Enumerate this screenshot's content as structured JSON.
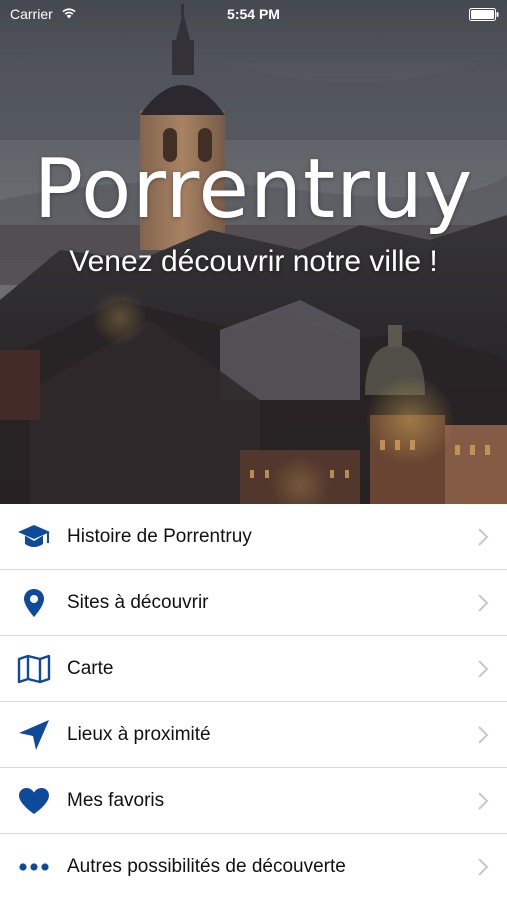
{
  "status_bar": {
    "carrier": "Carrier",
    "time": "5:54 PM"
  },
  "hero": {
    "title": "Porrentruy",
    "subtitle": "Venez découvrir notre ville !"
  },
  "colors": {
    "accent": "#0d4a9c",
    "separator": "#d9d9dc",
    "chevron": "#c7c7cc"
  },
  "menu": {
    "items": [
      {
        "label": "Histoire de Porrentruy",
        "icon": "graduation-cap-icon"
      },
      {
        "label": "Sites à découvrir",
        "icon": "map-pin-icon"
      },
      {
        "label": "Carte",
        "icon": "folded-map-icon"
      },
      {
        "label": "Lieux à proximité",
        "icon": "location-arrow-icon"
      },
      {
        "label": "Mes favoris",
        "icon": "heart-icon"
      },
      {
        "label": "Autres possibilités de découverte",
        "icon": "ellipsis-icon"
      }
    ]
  }
}
